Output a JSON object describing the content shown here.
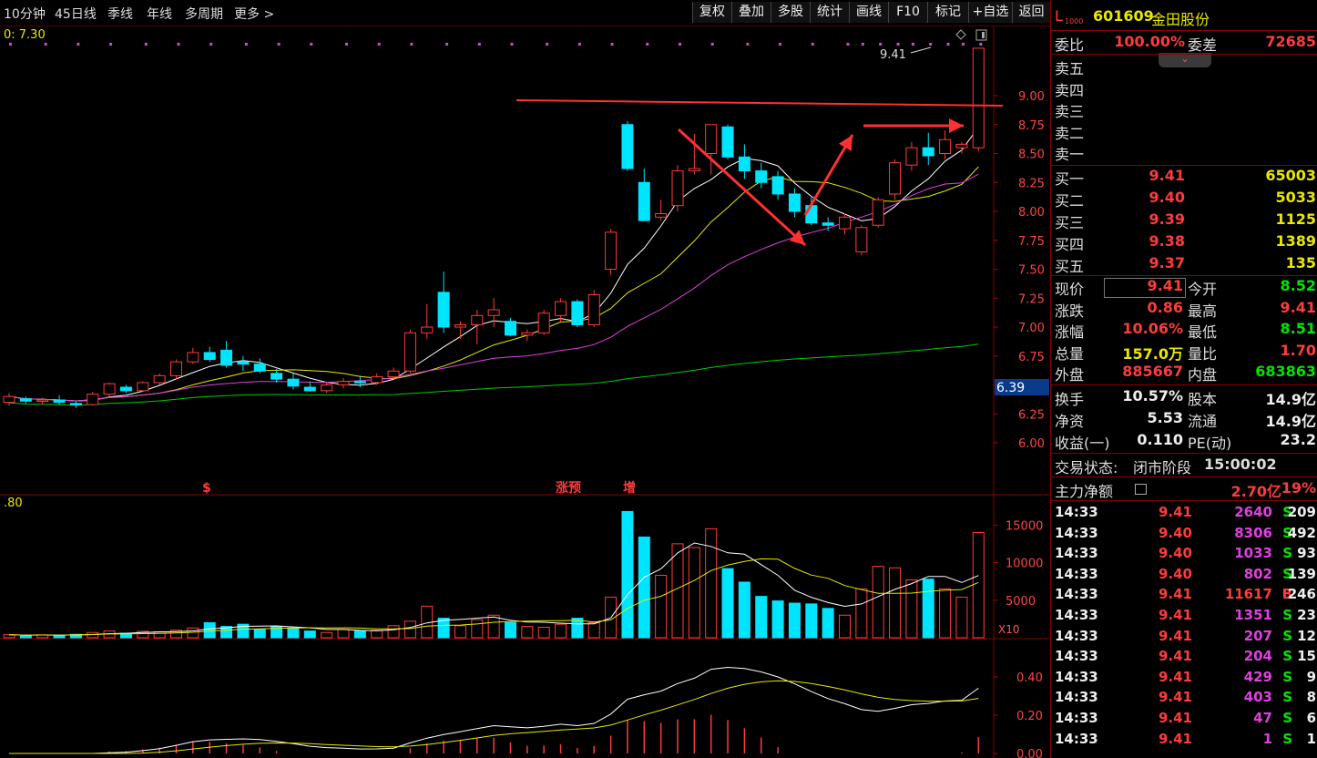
{
  "toolbar": {
    "tabs": [
      "10分钟",
      "45日线",
      "季线",
      "年线",
      "多周期",
      "更多 >"
    ],
    "buttons": [
      "复权",
      "叠加",
      "多股",
      "统计",
      "画线",
      "F10",
      "标记",
      "+自选",
      "返回"
    ]
  },
  "chart": {
    "ma_label": "0: 7.30",
    "price_ticks": [
      "9.00",
      "8.75",
      "8.50",
      "8.25",
      "8.00",
      "7.75",
      "7.50",
      "7.25",
      "7.00",
      "6.75",
      "6.50",
      "6.25",
      "6.00"
    ],
    "current_price_tag": "6.39",
    "last_price_annotation": "9.41",
    "signal_marks": [
      "$",
      "涨预",
      "增"
    ],
    "volume_label": ".80",
    "volume_ticks": [
      "15000",
      "10000",
      "5000"
    ],
    "volume_unit": "X10",
    "macd_ticks": [
      "0.40",
      "0.20",
      "0.00"
    ]
  },
  "chart_data": {
    "type": "candlestick",
    "price_ylim": [
      6.0,
      9.0
    ],
    "candles": [
      [
        6.35,
        6.43,
        6.32,
        6.4
      ],
      [
        6.38,
        6.4,
        6.34,
        6.36
      ],
      [
        6.36,
        6.39,
        6.33,
        6.37
      ],
      [
        6.37,
        6.41,
        6.33,
        6.35
      ],
      [
        6.34,
        6.36,
        6.3,
        6.33
      ],
      [
        6.33,
        6.44,
        6.32,
        6.42
      ],
      [
        6.42,
        6.52,
        6.4,
        6.51
      ],
      [
        6.48,
        6.5,
        6.43,
        6.45
      ],
      [
        6.45,
        6.53,
        6.44,
        6.52
      ],
      [
        6.52,
        6.6,
        6.5,
        6.58
      ],
      [
        6.58,
        6.72,
        6.55,
        6.7
      ],
      [
        6.7,
        6.82,
        6.68,
        6.78
      ],
      [
        6.78,
        6.83,
        6.7,
        6.72
      ],
      [
        6.8,
        6.88,
        6.65,
        6.67
      ],
      [
        6.7,
        6.75,
        6.62,
        6.68
      ],
      [
        6.68,
        6.73,
        6.6,
        6.62
      ],
      [
        6.6,
        6.64,
        6.52,
        6.55
      ],
      [
        6.55,
        6.6,
        6.46,
        6.49
      ],
      [
        6.48,
        6.53,
        6.44,
        6.45
      ],
      [
        6.45,
        6.52,
        6.43,
        6.5
      ],
      [
        6.5,
        6.56,
        6.47,
        6.53
      ],
      [
        6.53,
        6.58,
        6.48,
        6.52
      ],
      [
        6.52,
        6.6,
        6.5,
        6.57
      ],
      [
        6.57,
        6.65,
        6.55,
        6.62
      ],
      [
        6.62,
        6.98,
        6.6,
        6.95
      ],
      [
        6.95,
        7.2,
        6.9,
        7.0
      ],
      [
        7.3,
        7.48,
        6.95,
        7.0
      ],
      [
        7.0,
        7.05,
        6.9,
        7.02
      ],
      [
        7.02,
        7.15,
        6.85,
        7.1
      ],
      [
        7.1,
        7.25,
        7.0,
        7.15
      ],
      [
        7.05,
        7.08,
        6.92,
        6.93
      ],
      [
        6.93,
        6.98,
        6.88,
        6.95
      ],
      [
        6.95,
        7.15,
        6.93,
        7.12
      ],
      [
        7.1,
        7.25,
        7.05,
        7.22
      ],
      [
        7.22,
        7.24,
        7.0,
        7.02
      ],
      [
        7.02,
        7.32,
        7.0,
        7.28
      ],
      [
        7.5,
        7.85,
        7.45,
        7.82
      ],
      [
        8.75,
        8.78,
        8.35,
        8.37
      ],
      [
        8.25,
        8.37,
        7.92,
        7.92
      ],
      [
        7.95,
        8.1,
        7.92,
        7.98
      ],
      [
        8.05,
        8.4,
        8.0,
        8.35
      ],
      [
        8.35,
        8.67,
        8.32,
        8.37
      ],
      [
        8.5,
        8.72,
        8.32,
        8.75
      ],
      [
        8.73,
        8.75,
        8.45,
        8.47
      ],
      [
        8.47,
        8.58,
        8.28,
        8.35
      ],
      [
        8.35,
        8.42,
        8.2,
        8.25
      ],
      [
        8.3,
        8.35,
        8.1,
        8.15
      ],
      [
        8.15,
        8.2,
        7.95,
        8.0
      ],
      [
        8.05,
        8.12,
        7.88,
        7.9
      ],
      [
        7.9,
        7.95,
        7.83,
        7.88
      ],
      [
        7.85,
        7.98,
        7.8,
        7.95
      ],
      [
        7.65,
        7.88,
        7.62,
        7.86
      ],
      [
        7.88,
        8.12,
        7.86,
        8.1
      ],
      [
        8.15,
        8.45,
        8.1,
        8.42
      ],
      [
        8.4,
        8.6,
        8.35,
        8.55
      ],
      [
        8.55,
        8.68,
        8.4,
        8.48
      ],
      [
        8.5,
        8.7,
        8.45,
        8.62
      ],
      [
        8.55,
        8.6,
        8.5,
        8.58
      ],
      [
        8.55,
        9.41,
        8.52,
        9.41
      ]
    ],
    "volumes": [
      400,
      300,
      380,
      320,
      450,
      700,
      900,
      600,
      850,
      800,
      1000,
      1300,
      2000,
      1500,
      1800,
      1100,
      1500,
      1300,
      900,
      700,
      1100,
      900,
      1000,
      1600,
      2200,
      4200,
      2600,
      1600,
      2400,
      3000,
      2000,
      1500,
      1400,
      1800,
      2600,
      2000,
      5400,
      16800,
      13400,
      8300,
      12500,
      12000,
      14500,
      9200,
      7400,
      5500,
      4900,
      4600,
      4500,
      3900,
      3000,
      6500,
      9500,
      9300,
      7700,
      7800,
      6500,
      5400,
      14000
    ],
    "volume_ylim": [
      0,
      16000
    ],
    "macd_ylim": [
      0.0,
      0.45
    ]
  },
  "quote": {
    "symbol_prefix": "L",
    "level": "1000",
    "code": "601609",
    "name": "金田股份",
    "weibi_label": "委比",
    "weibi": "100.00%",
    "weicha_label": "委差",
    "weicha": "72685",
    "asks": [
      {
        "label": "卖五",
        "price": "",
        "vol": ""
      },
      {
        "label": "卖四",
        "price": "",
        "vol": ""
      },
      {
        "label": "卖三",
        "price": "",
        "vol": ""
      },
      {
        "label": "卖二",
        "price": "",
        "vol": ""
      },
      {
        "label": "卖一",
        "price": "",
        "vol": ""
      }
    ],
    "bids": [
      {
        "label": "买一",
        "price": "9.41",
        "vol": "65003"
      },
      {
        "label": "买二",
        "price": "9.40",
        "vol": "5033"
      },
      {
        "label": "买三",
        "price": "9.39",
        "vol": "1125"
      },
      {
        "label": "买四",
        "price": "9.38",
        "vol": "1389"
      },
      {
        "label": "买五",
        "price": "9.37",
        "vol": "135"
      }
    ],
    "stats": [
      {
        "l1": "现价",
        "v1": "9.41",
        "l2": "今开",
        "v2": "8.52",
        "c1": "red",
        "c2": "green"
      },
      {
        "l1": "涨跌",
        "v1": "0.86",
        "l2": "最高",
        "v2": "9.41",
        "c1": "red",
        "c2": "red"
      },
      {
        "l1": "涨幅",
        "v1": "10.06%",
        "l2": "最低",
        "v2": "8.51",
        "c1": "red",
        "c2": "green"
      },
      {
        "l1": "总量",
        "v1": "157.0万",
        "l2": "量比",
        "v2": "1.70",
        "c1": "yellow",
        "c2": "red"
      },
      {
        "l1": "外盘",
        "v1": "885667",
        "l2": "内盘",
        "v2": "683863",
        "c1": "red",
        "c2": "green"
      }
    ],
    "funds": [
      {
        "l1": "换手",
        "v1": "10.57%",
        "l2": "股本",
        "v2": "14.9亿"
      },
      {
        "l1": "净资",
        "v1": "5.53",
        "l2": "流通",
        "v2": "14.9亿"
      },
      {
        "l1": "收益(一)",
        "v1": "0.110",
        "l2": "PE(动)",
        "v2": "23.2"
      }
    ],
    "trade_status_label": "交易状态:",
    "trade_status": "闭市阶段",
    "trade_time": "15:00:02",
    "main_net_label": "主力净额",
    "main_net": "2.70亿",
    "main_net_pct": "19%"
  },
  "ticks": [
    {
      "time": "14:33",
      "price": "9.41",
      "vol": "2640",
      "side": "S",
      "n": "209"
    },
    {
      "time": "14:33",
      "price": "9.40",
      "vol": "8306",
      "side": "S",
      "n": "492"
    },
    {
      "time": "14:33",
      "price": "9.40",
      "vol": "1033",
      "side": "S",
      "n": "93"
    },
    {
      "time": "14:33",
      "price": "9.40",
      "vol": "802",
      "side": "S",
      "n": "139"
    },
    {
      "time": "14:33",
      "price": "9.41",
      "vol": "11617",
      "side": "B",
      "n": "246"
    },
    {
      "time": "14:33",
      "price": "9.41",
      "vol": "1351",
      "side": "S",
      "n": "23"
    },
    {
      "time": "14:33",
      "price": "9.41",
      "vol": "207",
      "side": "S",
      "n": "12"
    },
    {
      "time": "14:33",
      "price": "9.41",
      "vol": "204",
      "side": "S",
      "n": "15"
    },
    {
      "time": "14:33",
      "price": "9.41",
      "vol": "429",
      "side": "S",
      "n": "9"
    },
    {
      "time": "14:33",
      "price": "9.41",
      "vol": "403",
      "side": "S",
      "n": "8"
    },
    {
      "time": "14:33",
      "price": "9.41",
      "vol": "47",
      "side": "S",
      "n": "6"
    },
    {
      "time": "14:33",
      "price": "9.41",
      "vol": "1",
      "side": "S",
      "n": "1"
    }
  ],
  "colors": {
    "up": "#ff3b3b",
    "down": "#00e5ff",
    "ma5": "#ffffff",
    "ma10": "#e8e800",
    "ma20": "#e040e0",
    "ma60": "#00cc00",
    "accent": "#8b0000"
  }
}
